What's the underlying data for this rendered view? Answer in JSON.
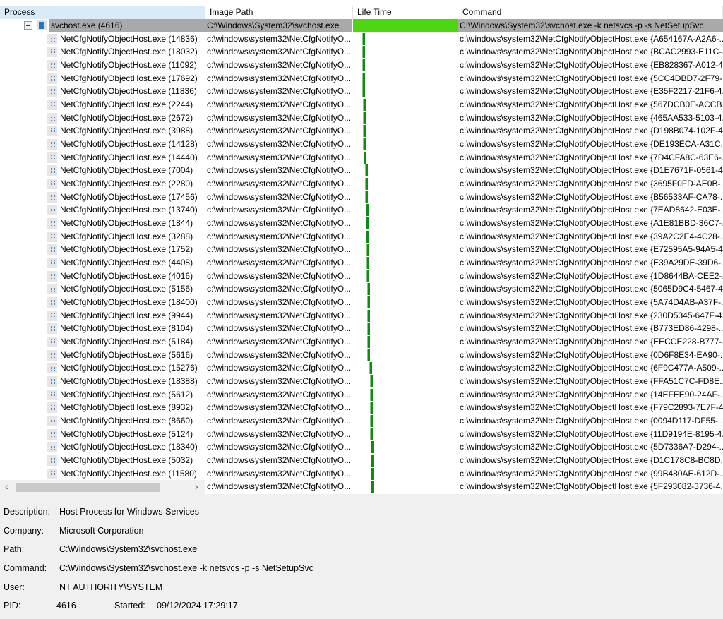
{
  "columns": {
    "process": "Process",
    "image_path": "Image Path",
    "life_time": "Life Time",
    "command": "Command"
  },
  "colors": {
    "parent_bar": "#4cd611",
    "child_bar": "#118a11",
    "selected_row": "#a9a9a9",
    "header_selected": "#d9ebf9"
  },
  "parent": {
    "name": "svchost.exe (4616)",
    "path": "C:\\Windows\\System32\\svchost.exe",
    "command": "C:\\Windows\\System32\\svchost.exe -k netsvcs -p -s NetSetupSvc",
    "icon": "service-window-icon",
    "life_start_pct": 0,
    "life_width_pct": 100
  },
  "children_path": "c:\\windows\\system32\\NetCfgNotifyO...",
  "children": [
    {
      "name": "NetCfgNotifyObjectHost.exe (14836)",
      "command": "c:\\windows\\system32\\NetCfgNotifyObjectHost.exe {A654167A-A2A6-...",
      "life_start_pct": 8.6
    },
    {
      "name": "NetCfgNotifyObjectHost.exe (18032)",
      "command": "c:\\windows\\system32\\NetCfgNotifyObjectHost.exe {BCAC2993-E11C-...",
      "life_start_pct": 8.6
    },
    {
      "name": "NetCfgNotifyObjectHost.exe (11092)",
      "command": "c:\\windows\\system32\\NetCfgNotifyObjectHost.exe {EB828367-A012-4...",
      "life_start_pct": 8.6
    },
    {
      "name": "NetCfgNotifyObjectHost.exe (17692)",
      "command": "c:\\windows\\system32\\NetCfgNotifyObjectHost.exe {5CC4DBD7-2F79-...",
      "life_start_pct": 9.0
    },
    {
      "name": "NetCfgNotifyObjectHost.exe (11836)",
      "command": "c:\\windows\\system32\\NetCfgNotifyObjectHost.exe {E35F2217-21F6-4...",
      "life_start_pct": 9.0
    },
    {
      "name": "NetCfgNotifyObjectHost.exe (2244)",
      "command": "c:\\windows\\system32\\NetCfgNotifyObjectHost.exe {567DCB0E-ACCB...",
      "life_start_pct": 9.4
    },
    {
      "name": "NetCfgNotifyObjectHost.exe (2672)",
      "command": "c:\\windows\\system32\\NetCfgNotifyObjectHost.exe {465AA533-5103-4...",
      "life_start_pct": 9.7
    },
    {
      "name": "NetCfgNotifyObjectHost.exe (3988)",
      "command": "c:\\windows\\system32\\NetCfgNotifyObjectHost.exe {D198B074-102F-4...",
      "life_start_pct": 9.7
    },
    {
      "name": "NetCfgNotifyObjectHost.exe (14128)",
      "command": "c:\\windows\\system32\\NetCfgNotifyObjectHost.exe {DE193ECA-A31C...",
      "life_start_pct": 9.7
    },
    {
      "name": "NetCfgNotifyObjectHost.exe (14440)",
      "command": "c:\\windows\\system32\\NetCfgNotifyObjectHost.exe {7D4CFA8C-63E6-...",
      "life_start_pct": 10.1
    },
    {
      "name": "NetCfgNotifyObjectHost.exe (7004)",
      "command": "c:\\windows\\system32\\NetCfgNotifyObjectHost.exe {D1E7671F-0561-4...",
      "life_start_pct": 11.7
    },
    {
      "name": "NetCfgNotifyObjectHost.exe (2280)",
      "command": "c:\\windows\\system32\\NetCfgNotifyObjectHost.exe {3695F0FD-AE0B-...",
      "life_start_pct": 11.7
    },
    {
      "name": "NetCfgNotifyObjectHost.exe (17456)",
      "command": "c:\\windows\\system32\\NetCfgNotifyObjectHost.exe {B56533AF-CA78-...",
      "life_start_pct": 11.7
    },
    {
      "name": "NetCfgNotifyObjectHost.exe (13740)",
      "command": "c:\\windows\\system32\\NetCfgNotifyObjectHost.exe {7EAD8642-E03E-...",
      "life_start_pct": 12.1
    },
    {
      "name": "NetCfgNotifyObjectHost.exe (1844)",
      "command": "c:\\windows\\system32\\NetCfgNotifyObjectHost.exe {A1E81BBD-36C7-...",
      "life_start_pct": 12.1
    },
    {
      "name": "NetCfgNotifyObjectHost.exe (3288)",
      "command": "c:\\windows\\system32\\NetCfgNotifyObjectHost.exe {39A2C2E4-4C28-...",
      "life_start_pct": 12.4
    },
    {
      "name": "NetCfgNotifyObjectHost.exe (1752)",
      "command": "c:\\windows\\system32\\NetCfgNotifyObjectHost.exe {E72595A5-94A5-4...",
      "life_start_pct": 12.8
    },
    {
      "name": "NetCfgNotifyObjectHost.exe (4408)",
      "command": "c:\\windows\\system32\\NetCfgNotifyObjectHost.exe {E39A29DE-39D6-...",
      "life_start_pct": 12.8
    },
    {
      "name": "NetCfgNotifyObjectHost.exe (4016)",
      "command": "c:\\windows\\system32\\NetCfgNotifyObjectHost.exe {1D8644BA-CEE2-...",
      "life_start_pct": 12.8
    },
    {
      "name": "NetCfgNotifyObjectHost.exe (5156)",
      "command": "c:\\windows\\system32\\NetCfgNotifyObjectHost.exe {5065D9C4-5467-4...",
      "life_start_pct": 13.2
    },
    {
      "name": "NetCfgNotifyObjectHost.exe (18400)",
      "command": "c:\\windows\\system32\\NetCfgNotifyObjectHost.exe {5A74D4AB-A37F-...",
      "life_start_pct": 13.2
    },
    {
      "name": "NetCfgNotifyObjectHost.exe (9944)",
      "command": "c:\\windows\\system32\\NetCfgNotifyObjectHost.exe {230D5345-647F-4...",
      "life_start_pct": 13.2
    },
    {
      "name": "NetCfgNotifyObjectHost.exe (8104)",
      "command": "c:\\windows\\system32\\NetCfgNotifyObjectHost.exe {B773ED86-4298-...",
      "life_start_pct": 13.5
    },
    {
      "name": "NetCfgNotifyObjectHost.exe (5184)",
      "command": "c:\\windows\\system32\\NetCfgNotifyObjectHost.exe {EECCE228-B777-...",
      "life_start_pct": 13.5
    },
    {
      "name": "NetCfgNotifyObjectHost.exe (5616)",
      "command": "c:\\windows\\system32\\NetCfgNotifyObjectHost.exe {0D6F8E34-EA90-...",
      "life_start_pct": 13.5
    },
    {
      "name": "NetCfgNotifyObjectHost.exe (15276)",
      "command": "c:\\windows\\system32\\NetCfgNotifyObjectHost.exe {6F9C477A-A509-...",
      "life_start_pct": 15.3
    },
    {
      "name": "NetCfgNotifyObjectHost.exe (18388)",
      "command": "c:\\windows\\system32\\NetCfgNotifyObjectHost.exe {FFA51C7C-FD8E...",
      "life_start_pct": 16.0
    },
    {
      "name": "NetCfgNotifyObjectHost.exe (5612)",
      "command": "c:\\windows\\system32\\NetCfgNotifyObjectHost.exe {14EFEE90-24AF-...",
      "life_start_pct": 16.0
    },
    {
      "name": "NetCfgNotifyObjectHost.exe (8932)",
      "command": "c:\\windows\\system32\\NetCfgNotifyObjectHost.exe {F79C2893-7E7F-4...",
      "life_start_pct": 16.3
    },
    {
      "name": "NetCfgNotifyObjectHost.exe (8660)",
      "command": "c:\\windows\\system32\\NetCfgNotifyObjectHost.exe {0094D117-DF55-...",
      "life_start_pct": 16.3
    },
    {
      "name": "NetCfgNotifyObjectHost.exe (5124)",
      "command": "c:\\windows\\system32\\NetCfgNotifyObjectHost.exe {11D9194E-8195-4...",
      "life_start_pct": 16.3
    },
    {
      "name": "NetCfgNotifyObjectHost.exe (18340)",
      "command": "c:\\windows\\system32\\NetCfgNotifyObjectHost.exe {5D7336A7-D294-...",
      "life_start_pct": 16.7
    },
    {
      "name": "NetCfgNotifyObjectHost.exe (5032)",
      "command": "c:\\windows\\system32\\NetCfgNotifyObjectHost.exe {D1C178C8-BC8D...",
      "life_start_pct": 16.7
    },
    {
      "name": "NetCfgNotifyObjectHost.exe (11580)",
      "command": "c:\\windows\\system32\\NetCfgNotifyObjectHost.exe {99B480AE-612D-...",
      "life_start_pct": 17.0
    },
    {
      "name": "",
      "command": "c:\\windows\\system32\\NetCfgNotifyObjectHost.exe {5F293082-3736-4...",
      "life_start_pct": 17.0
    }
  ],
  "details": {
    "description_label": "Description:",
    "description": "Host Process for Windows Services",
    "company_label": "Company:",
    "company": "Microsoft Corporation",
    "path_label": "Path:",
    "path": "C:\\Windows\\System32\\svchost.exe",
    "command_label": "Command:",
    "command": "C:\\Windows\\System32\\svchost.exe -k netsvcs -p -s NetSetupSvc",
    "user_label": "User:",
    "user": "NT AUTHORITY\\SYSTEM",
    "pid_label": "PID:",
    "pid": "4616",
    "started_label": "Started:",
    "started": "09/12/2024 17:29:17"
  },
  "scrollbar": {
    "left_arrow": "‹",
    "right_arrow": "›"
  }
}
